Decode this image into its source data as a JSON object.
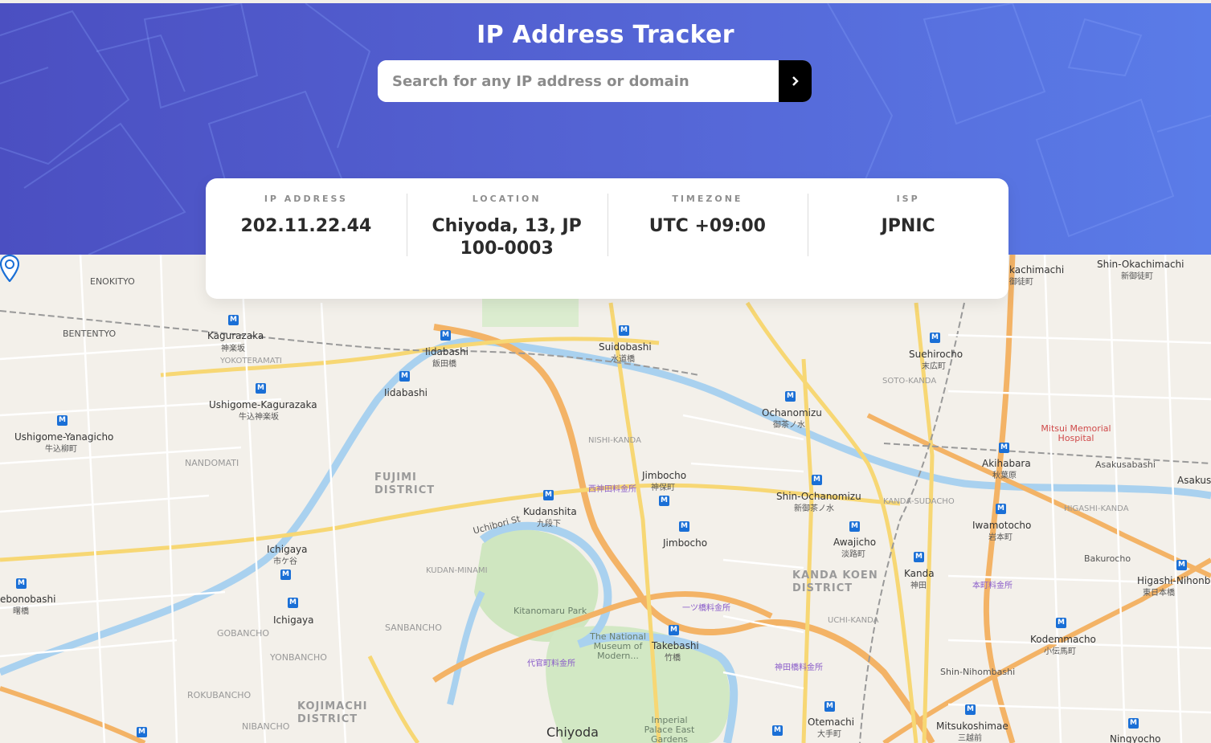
{
  "app": {
    "title": "IP Address Tracker"
  },
  "search": {
    "placeholder": "Search for any IP address or domain",
    "value": ""
  },
  "info": {
    "ip": {
      "label": "IP ADDRESS",
      "value": "202.11.22.44"
    },
    "location": {
      "label": "LOCATION",
      "value": "Chiyoda, 13, JP 100-0003"
    },
    "timezone": {
      "label": "TIMEZONE",
      "value": "UTC +09:00"
    },
    "isp": {
      "label": "ISP",
      "value": "JPNIC"
    }
  },
  "map": {
    "labels": {
      "enokityo": "ENOKITYO",
      "bententyo": "BENTENTYO",
      "kagurazaka": "Kagurazaka",
      "kagurazaka_jp": "神楽坂",
      "yokoteramati": "YOKOTERAMATI",
      "ushigome_kagurazaka": "Ushigome-Kagurazaka",
      "ushigome_kagurazaka_jp": "牛込神楽坂",
      "ushigome_yanagicho": "Ushigome-Yanagicho",
      "ushigome_yanagicho_jp": "牛込柳町",
      "iidabashi": "Iidabashi",
      "iidabashi_jp": "飯田橋",
      "suidobashi": "Suidobashi",
      "suidobashi_jp": "水道橋",
      "ochanomizu": "Ochanomizu",
      "ochanomizu_jp": "御茶ノ水",
      "shin_ochanomizu": "Shin-Ochanomizu",
      "shin_ochanomizu_jp": "新御茶ノ水",
      "jimbocho": "Jimbocho",
      "jimbocho_jp": "神保町",
      "kudanshita": "Kudanshita",
      "kudanshita_jp": "九段下",
      "fujimi_district": "FUJIMI DISTRICT",
      "kanda_koen_district": "KANDA KOEN DISTRICT",
      "kojimachi_district": "KOJIMACHI DISTRICT",
      "ichigaya": "Ichigaya",
      "ichigaya_jp": "市ケ谷",
      "kitanomaru": "Kitanomaru Park",
      "museum": "The National Museum of Modern...",
      "takebashi": "Takebashi",
      "takebashi_jp": "竹橋",
      "imperial": "Imperial Palace East Gardens",
      "chiyoda": "Chiyoda",
      "otemachi": "Otemachi",
      "otemachi_jp": "大手町",
      "kanda": "Kanda",
      "kanda_jp": "神田",
      "awajicho": "Awajicho",
      "awajicho_jp": "淡路町",
      "akihabara": "Akihabara",
      "akihabara_jp": "秋葉原",
      "iwamotocho": "Iwamotocho",
      "iwamotocho_jp": "岩本町",
      "suehirocho": "Suehirocho",
      "suehirocho_jp": "末広町",
      "mitsui_hospital": "Mitsui Memorial Hospital",
      "kodemmacho": "Kodemmacho",
      "kodemmacho_jp": "小伝馬町",
      "mitsukoshimae": "Mitsukoshimae",
      "mitsukoshimae_jp": "三越前",
      "shin_nihombashi": "Shin-Nihombashi",
      "shin_okachimachi": "Shin-Okachimachi",
      "shin_okachimachi_jp": "新御徒町",
      "okachimachi": "kachimachi",
      "okachimachi_jp": "御徒町",
      "bakurocho": "Bakurocho",
      "higashi_nihonbashi": "Higashi-Nihonba",
      "higashi_nihonbashi_jp": "東日本橋",
      "asakusabashi": "Asakusabashi",
      "asakus": "Asakus",
      "ningyocho": "Ningyocho",
      "ebonobashi": "ebonobashi",
      "ebonobashi_jp": "曙橋",
      "nandomati": "NANDOMATI",
      "sanbancho": "SANBANCHO",
      "yonbancho": "YONBANCHO",
      "rokubancho": "ROKUBANCHO",
      "nibancho": "NIBANCHO",
      "gobancho": "GOBANCHO",
      "uchibori_st": "Uchibori St",
      "kudan_minami": "KUDAN-MINAMI",
      "nishi_kanda": "NISHI-KANDA",
      "kanda_sudacho": "KANDA-SUDACHO",
      "higashi_kanda": "HIGASHI-KANDA",
      "uchi_kanda": "UCHI-KANDA",
      "sotokanda": "SOTO-KANDA",
      "nishikanda_toll": "西神田料金所",
      "hitotsubashi_toll": "一ツ橋料金所",
      "jinbashi_toll": "神田橋料金所",
      "daikancho_toll": "代官町料金所",
      "honcho_toll": "本町料金所"
    }
  }
}
